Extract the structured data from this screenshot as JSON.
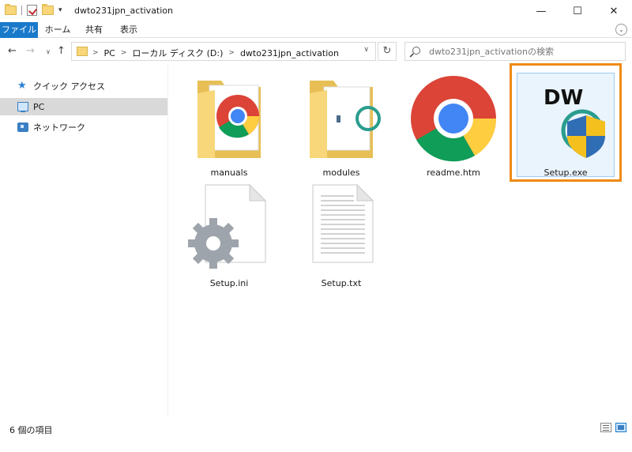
{
  "window": {
    "title": "dwto231jpn_activation",
    "minimize_glyph": "—",
    "maximize_glyph": "☐",
    "close_glyph": "✕"
  },
  "ribbon": {
    "tabs": [
      "ファイル",
      "ホーム",
      "共有",
      "表示"
    ],
    "expand_glyph": "⌄",
    "file_tab_color": "#1979ca"
  },
  "nav": {
    "back_glyph": "←",
    "forward_glyph": "→",
    "recent_glyph": "∨",
    "up_glyph": "↑",
    "refresh_glyph": "↻",
    "breadcrumb": [
      "PC",
      "ローカル ディスク (D:)",
      "dwto231jpn_activation"
    ],
    "crumb_sep": ">",
    "address_dropdown_glyph": "∨",
    "search_placeholder": "dwto231jpn_activationの検索"
  },
  "sidebar": {
    "items": [
      {
        "label": "クイック アクセス",
        "icon": "star-icon"
      },
      {
        "label": "PC",
        "icon": "pc-icon",
        "selected": true
      },
      {
        "label": "ネットワーク",
        "icon": "network-icon"
      }
    ]
  },
  "files": [
    {
      "name": "manuals",
      "type": "folder",
      "icon": "chrome-folder-icon"
    },
    {
      "name": "modules",
      "type": "folder",
      "icon": "folder-icon"
    },
    {
      "name": "readme.htm",
      "type": "file",
      "icon": "chrome-icon"
    },
    {
      "name": "Setup.exe",
      "type": "file",
      "icon": "dw-setup-icon",
      "selected": true,
      "logo_text": "DW"
    },
    {
      "name": "Setup.ini",
      "type": "file",
      "icon": "settings-file-icon"
    },
    {
      "name": "Setup.txt",
      "type": "file",
      "icon": "text-file-icon"
    }
  ],
  "status": {
    "item_count": "6 個の項目"
  },
  "colors": {
    "highlight": "#ee8a14",
    "selection_bg": "#eaf4fd",
    "selection_border": "#9ccbf2",
    "accent": "#1979ca"
  }
}
